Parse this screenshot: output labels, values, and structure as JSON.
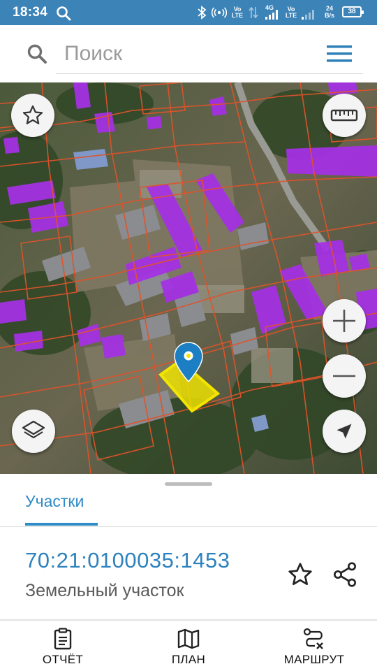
{
  "status_bar": {
    "time": "18:34",
    "net1_top": "Vo",
    "net1_bottom": "LTE",
    "net2_top": "4G",
    "net3_top": "Vo",
    "net3_bottom": "LTE",
    "speed_value": "24",
    "speed_unit": "B/s",
    "battery": "38"
  },
  "search": {
    "placeholder": "Поиск"
  },
  "map": {
    "selected_parcel_color": "#f2e500",
    "building_color": "#a035e0",
    "boundary_color": "#e0532a",
    "marker_color": "#1c7fc4"
  },
  "sheet": {
    "tab_label": "Участки",
    "parcel_number": "70:21:0100035:1453",
    "parcel_type": "Земельный участок"
  },
  "bottom_nav": {
    "report_label": "ОТЧЁТ",
    "plan_label": "ПЛАН",
    "route_label": "МАРШРУТ"
  },
  "colors": {
    "accent": "#2e8bc6",
    "status_bar": "#3c83b8"
  }
}
